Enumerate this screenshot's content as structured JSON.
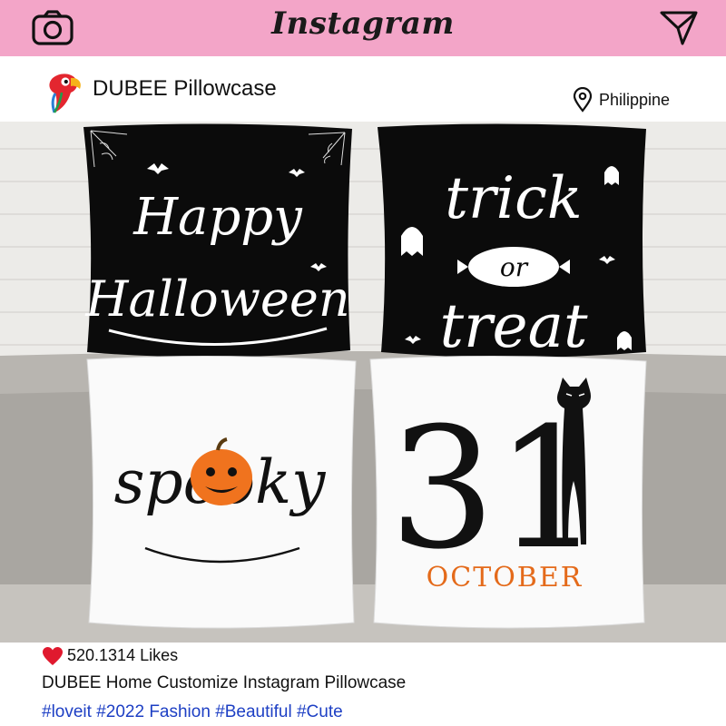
{
  "header": {
    "brand": "Instagram",
    "camera_icon": "camera-icon",
    "send_icon": "send-icon",
    "background": "#f3a5c8"
  },
  "profile": {
    "name": "DUBEE Pillowcase",
    "location": "Philippine",
    "logo_icon": "parrot-logo-icon",
    "location_icon": "location-pin-icon"
  },
  "post": {
    "pillows": [
      {
        "name": "pillow-happy-halloween",
        "text_top": "Happy",
        "text_bottom": "Halloween"
      },
      {
        "name": "pillow-trick-or-treat",
        "text_top": "trick",
        "text_middle": "or",
        "text_bottom": "treat"
      },
      {
        "name": "pillow-spooky",
        "text": "spooky"
      },
      {
        "name": "pillow-31-october",
        "number": "31",
        "text": "OCTOBER"
      }
    ],
    "likes": "520.1314 Likes",
    "caption": "DUBEE Home Customize Instagram Pillowcase",
    "hashtags": "#loveit #2022 Fashion #Beautiful #Cute",
    "heart_color": "#e0192e",
    "hashtag_color": "#1d3fc4"
  }
}
